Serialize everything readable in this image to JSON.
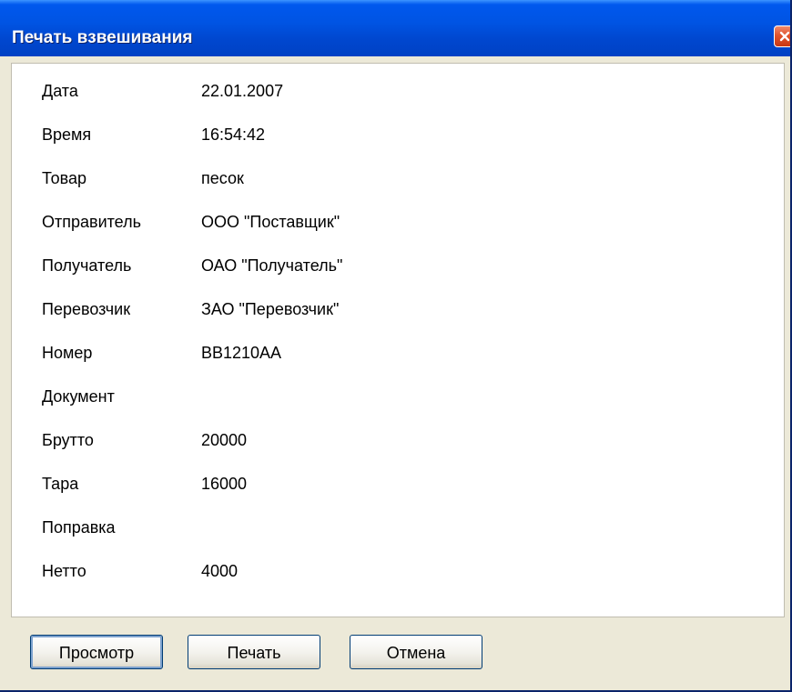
{
  "window": {
    "title": "Печать взвешивания"
  },
  "fields": [
    {
      "label": "Дата",
      "value": "22.01.2007"
    },
    {
      "label": "Время",
      "value": "16:54:42"
    },
    {
      "label": "Товар",
      "value": "песок"
    },
    {
      "label": "Отправитель",
      "value": "ООО \"Поставщик\""
    },
    {
      "label": "Получатель",
      "value": "ОАО \"Получатель\""
    },
    {
      "label": "Перевозчик",
      "value": "ЗАО \"Перевозчик\""
    },
    {
      "label": "Номер",
      "value": "ВВ1210АА"
    },
    {
      "label": "Документ",
      "value": ""
    },
    {
      "label": "Брутто",
      "value": "20000"
    },
    {
      "label": "Тара",
      "value": "16000"
    },
    {
      "label": "Поправка",
      "value": ""
    },
    {
      "label": "Нетто",
      "value": "4000"
    }
  ],
  "buttons": {
    "preview": "Просмотр",
    "print": "Печать",
    "cancel": "Отмена"
  },
  "icons": {
    "close": "close-icon"
  },
  "colors": {
    "titlebar": "#0054e3",
    "close_button": "#e0532c",
    "window_background": "#ece9d8",
    "button_border": "#003c74"
  }
}
